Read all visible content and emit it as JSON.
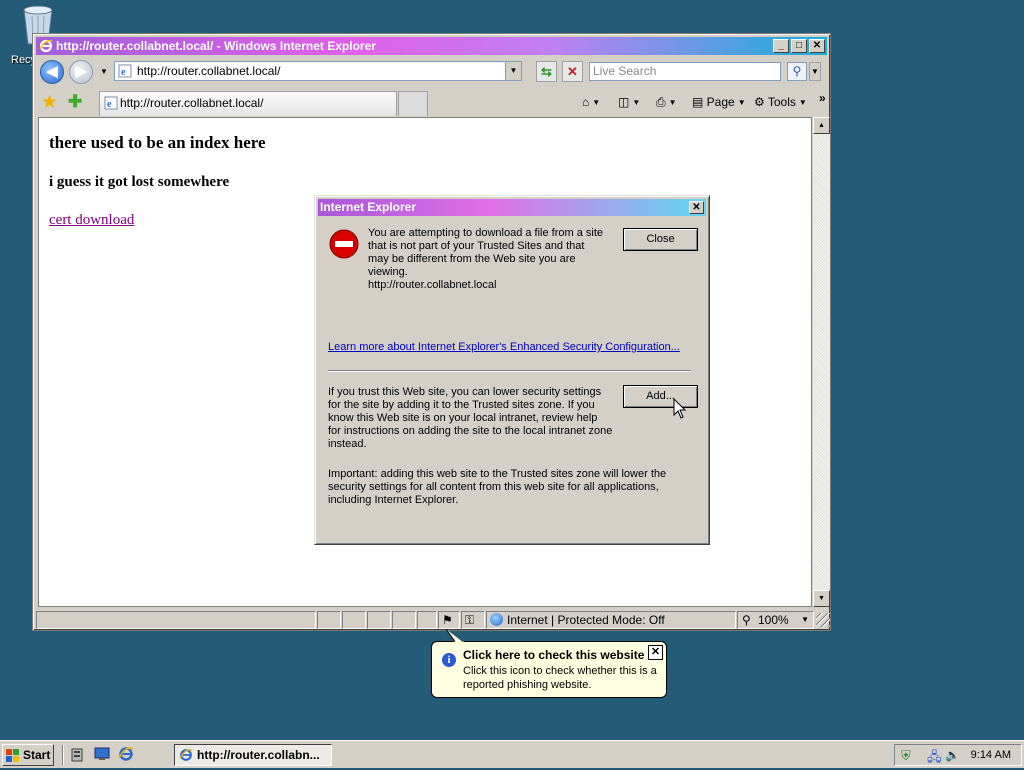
{
  "desktop": {
    "recycle_bin_label": "Recy"
  },
  "window": {
    "title": "http://router.collabnet.local/ - Windows Internet Explorer",
    "controls": {
      "minimize": "_",
      "maximize": "□",
      "close": "✕"
    }
  },
  "navbar": {
    "back_glyph": "◀",
    "forward_glyph": "▶",
    "address": "http://router.collabnet.local/",
    "search_placeholder": "Live Search"
  },
  "tabs": [
    {
      "label": "http://router.collabnet.local/"
    }
  ],
  "commands": {
    "page": "Page",
    "tools": "Tools",
    "more": "»"
  },
  "page": {
    "heading": "there used to be an index here",
    "subheading": "i guess it got lost somewhere",
    "link": "cert download"
  },
  "statusbar": {
    "zone": "Internet | Protected Mode: Off",
    "zoom": "100%"
  },
  "dialog": {
    "title": "Internet Explorer",
    "message": "You are attempting to download a file from a site that is not part of your Trusted Sites and that may be different from the Web site you are viewing.",
    "site": "http://router.collabnet.local",
    "close_label": "Close",
    "learn_more": "Learn more about Internet Explorer's Enhanced Security Configuration...",
    "trust_text": "If you trust this Web site, you can lower security settings for the site by adding it to the Trusted sites zone. If you know this Web site is on your local intranet, review help for instructions on adding the site to the local intranet zone instead.",
    "add_label": "Add...",
    "important_text": "Important: adding this web site to the Trusted sites zone will lower the security settings for all content from this web site for all applications, including Internet Explorer."
  },
  "balloon": {
    "title": "Click here to check this website",
    "body": "Click this icon to check whether this is a reported phishing website.",
    "close": "✕"
  },
  "taskbar": {
    "start_label": "Start",
    "task_label": "http://router.collabn...",
    "clock": "9:14 AM"
  }
}
